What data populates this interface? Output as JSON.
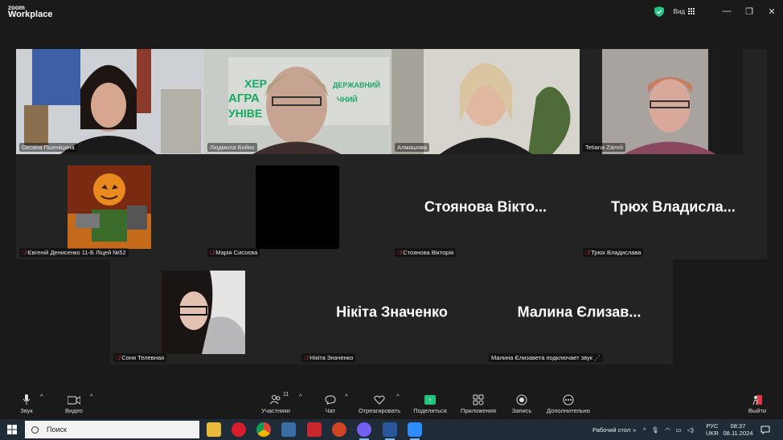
{
  "app": {
    "brand_small": "zoom",
    "brand_large": "Workplace",
    "view_label": "Вид"
  },
  "window_controls": {
    "minimize": "—",
    "restore": "❐",
    "close": "✕"
  },
  "participants": [
    {
      "name": "Оксана Пшеніцина",
      "muted": false,
      "video": true
    },
    {
      "name": "Людмила Бойко",
      "muted": false,
      "video": true
    },
    {
      "name": "Алмашова",
      "muted": false,
      "video": true,
      "active_speaker": true
    },
    {
      "name": "Tetiana Zamrii",
      "muted": false,
      "video": true
    },
    {
      "name": "Євгеній Денисенко 11-Б Ліцей №52",
      "muted": true,
      "video": false,
      "avatar": "pumpkin-avatar"
    },
    {
      "name": "Марія Сисоєва",
      "muted": true,
      "video": false,
      "avatar": "black-avatar"
    },
    {
      "name": "Стоянова Вікторія",
      "muted": true,
      "video": false,
      "display_name": "Стоянова  Вікто..."
    },
    {
      "name": "Трюх Владислава",
      "muted": true,
      "video": false,
      "display_name": "Трюх  Владисла..."
    },
    {
      "name": "Соня Телевная",
      "muted": true,
      "video": false,
      "avatar": "photo-avatar"
    },
    {
      "name": "Нікіта Значенко",
      "muted": true,
      "video": false,
      "display_name": "Нікіта Значенко"
    },
    {
      "name": "Малина Єлизавета подключает звук",
      "muted": false,
      "video": false,
      "display_name": "Малина  Єлизав...",
      "connecting_audio": true
    }
  ],
  "toolbar": {
    "audio": "Звук",
    "video": "Видео",
    "participants": "Участники",
    "participants_count": "11",
    "chat": "Чат",
    "react": "Отреагировать",
    "share": "Поделиться",
    "apps": "Приложения",
    "record": "Запись",
    "more": "Дополнительно",
    "leave": "Выйти"
  },
  "taskbar": {
    "search_placeholder": "Поиск",
    "desktop_label": "Рабочий стол",
    "lang1": "РУС",
    "lang2": "UKR",
    "time": "08:37",
    "date": "08.11.2024"
  },
  "colors": {
    "accent_green": "#22c47e",
    "muted_red": "#e0374a",
    "leave_red": "#e0374a"
  }
}
